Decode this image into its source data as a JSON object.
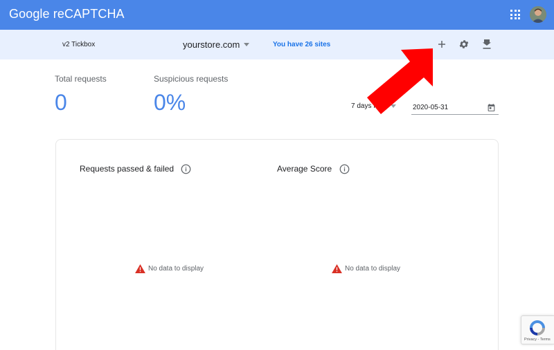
{
  "app": {
    "brand": "Google reCAPTCHA"
  },
  "sitebar": {
    "key_type": "v2 Tickbox",
    "site_name": "yourstore.com",
    "sites_count": "You have 26 sites"
  },
  "stats": {
    "total": {
      "label": "Total requests",
      "value": "0"
    },
    "suspicious": {
      "label": "Suspicious requests",
      "value": "0%"
    }
  },
  "range": {
    "selected": "7 days from",
    "date": "2020-05-31"
  },
  "charts": {
    "passed_failed": {
      "title": "Requests passed & failed",
      "empty": "No data to display"
    },
    "average_score": {
      "title": "Average Score",
      "empty": "No data to display"
    }
  },
  "badge": {
    "links": "Privacy - Terms"
  },
  "colors": {
    "appbar": "#4a86e8",
    "sitebar": "#e8f0fe",
    "accent": "#1a73e8",
    "stat_value": "#4a86e8",
    "warning": "#d93025",
    "annotation_arrow": "#ff0000"
  },
  "icons": {
    "apps": "apps-grid-icon",
    "add": "plus-icon",
    "settings": "gear-icon",
    "download": "download-icon",
    "calendar": "calendar-icon",
    "info": "info-icon",
    "warning": "warning-icon",
    "recaptcha": "recaptcha-logo-icon"
  }
}
